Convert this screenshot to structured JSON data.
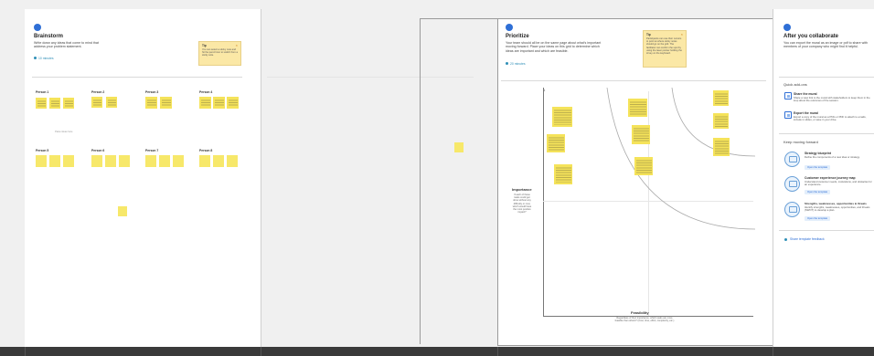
{
  "brainstorm": {
    "step": "1",
    "title": "Brainstorm",
    "description": "Write down any ideas that come to mind that address your problem statement.",
    "timer": "10 minutes",
    "tip": {
      "label": "Tip",
      "text": "You can select a sticky note and hit the pencil icon to switch from a sticky note."
    },
    "persons": [
      "Person 1",
      "Person 2",
      "Person 3",
      "Person 4",
      "Person 5",
      "Person 6",
      "Person 7",
      "Person 8"
    ],
    "note": "Paste ideas here"
  },
  "prioritize": {
    "step": "2",
    "title": "Prioritize",
    "description": "Your team should all be on the same page about what's important moving forward. Place your ideas on this grid to determine which ideas are important and which are feasible.",
    "timer": "20 minutes",
    "tip": {
      "label": "Tip",
      "text": "Participants can use their cursors to point at where sticky notes should go on the grid. The facilitator can confirm the spot by using the laser pointer holding the H key on the keyboard."
    },
    "y_axis": {
      "label": "Importance",
      "sub": "If each of these tasks could get done without any difficulty or cost, which would have the most positive impact?"
    },
    "x_axis": {
      "label": "Feasibility",
      "sub": "Regardless of their importance, which tasks are more feasible than others? (Cost, time, effort, complexity, etc.)"
    }
  },
  "collaborate": {
    "step": "3",
    "title": "After you collaborate",
    "description": "You can export the mural as an image or pdf to share with members of your company who might find it helpful.",
    "quick_add_ons": "Quick add-ons",
    "addons": [
      {
        "title": "Share the mural",
        "desc": "Share a view link to the mural with stakeholders to keep them in the loop about the outcomes of the session."
      },
      {
        "title": "Export the mural",
        "desc": "Export a copy of the mural as a PNG or PDF to attach to emails, include in slides, or save in your drive."
      }
    ],
    "keep_moving": "Keep moving forward",
    "templates": [
      {
        "title": "Strategy blueprint",
        "desc": "Define the components of a new idea or strategy.",
        "button": "Open the template"
      },
      {
        "title": "Customer experience journey map",
        "desc": "Understand customer needs, motivations, and obstacles for an experience.",
        "button": "Open the template"
      },
      {
        "title": "Strengths, weaknesses, opportunities & threats",
        "desc": "Identify strengths, weaknesses, opportunities, and threats (SWOT) to develop a plan.",
        "button": "Open the template"
      }
    ],
    "feedback": "Share template feedback"
  },
  "colors": {
    "accent": "#2f6fd6",
    "sticky": "#f7e86a",
    "tip": "#fbe8a6"
  }
}
